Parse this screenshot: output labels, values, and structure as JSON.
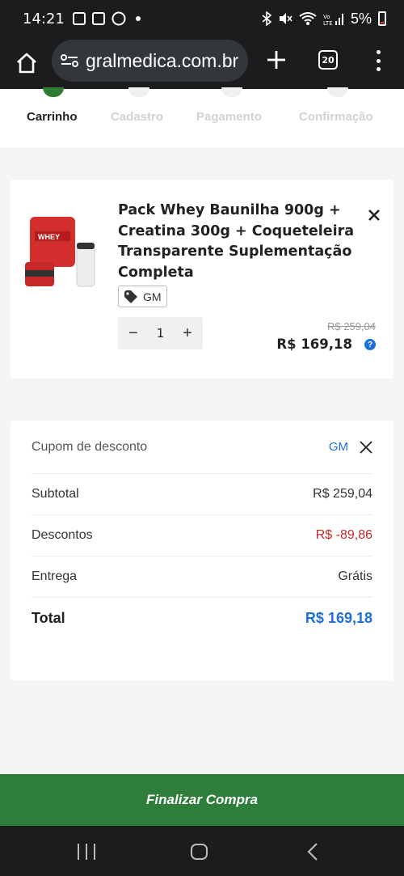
{
  "status_bar": {
    "time": "14:21",
    "battery": "5%"
  },
  "browser": {
    "url": "gralmedica.com.br",
    "tab_count": "20"
  },
  "steps": [
    {
      "label": "Carrinho",
      "active": true
    },
    {
      "label": "Cadastro",
      "active": false
    },
    {
      "label": "Pagamento",
      "active": false
    },
    {
      "label": "Confirmação",
      "active": false
    }
  ],
  "product": {
    "title": "Pack Whey Baunilha 900g + Creatina 300g + Coqueteleira Transparente Suplementação Completa",
    "coupon_tag": "GM",
    "quantity": "1",
    "old_price": "R$ 259,04",
    "price": "R$ 169,18"
  },
  "summary": {
    "coupon_label": "Cupom de desconto",
    "coupon_code": "GM",
    "subtotal_label": "Subtotal",
    "subtotal_value": "R$ 259,04",
    "discounts_label": "Descontos",
    "discounts_value": "R$ -89,86",
    "delivery_label": "Entrega",
    "delivery_value": "Grátis",
    "total_label": "Total",
    "total_value": "R$ 169,18"
  },
  "checkout_label": "Finalizar Compra",
  "colors": {
    "accent_green": "#2e7d3a",
    "link_blue": "#1e6fd9",
    "discount_red": "#c62828"
  }
}
